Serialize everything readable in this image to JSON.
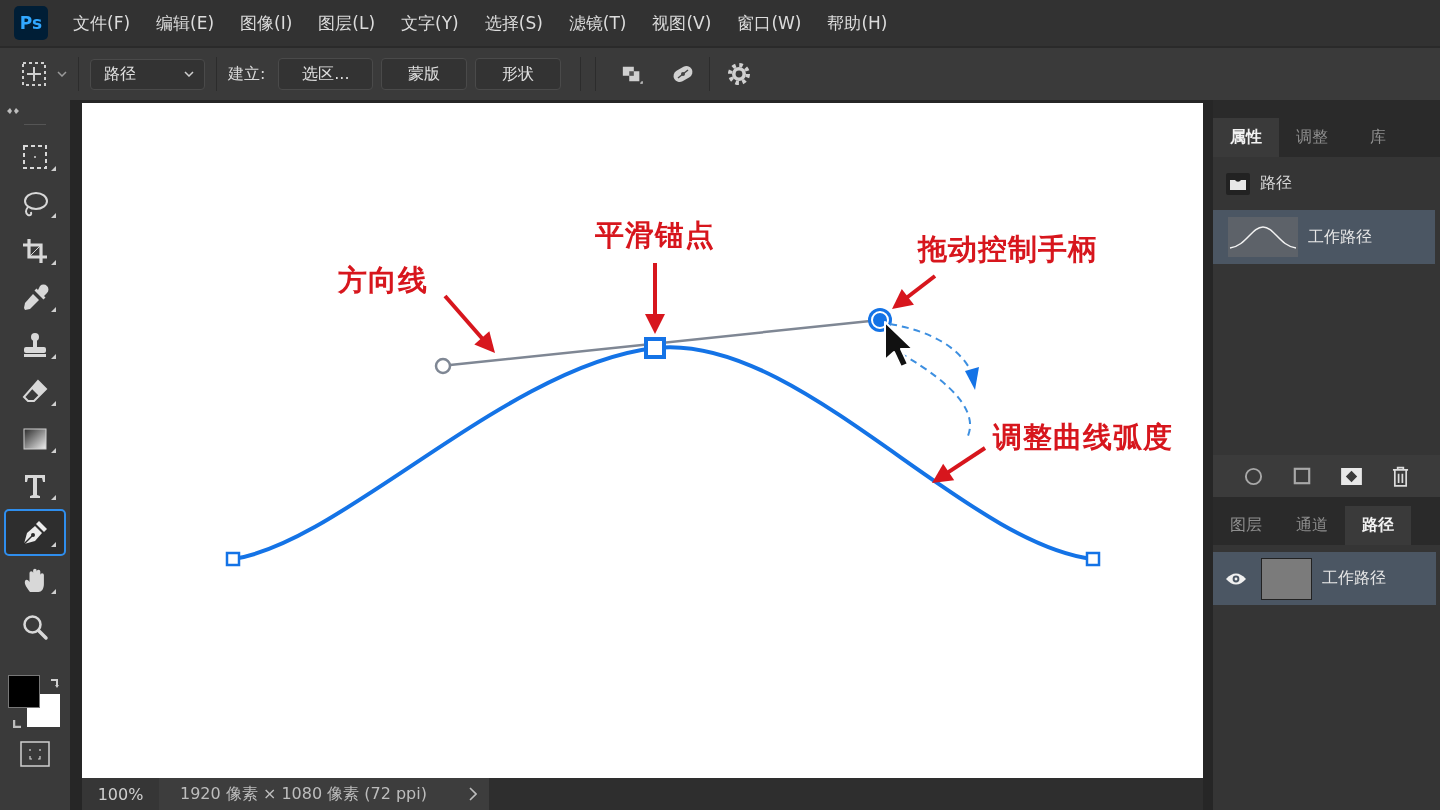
{
  "menu_bar": {
    "logo": "Ps",
    "items": [
      "文件(F)",
      "编辑(E)",
      "图像(I)",
      "图层(L)",
      "文字(Y)",
      "选择(S)",
      "滤镜(T)",
      "视图(V)",
      "窗口(W)",
      "帮助(H)"
    ]
  },
  "options_bar": {
    "mode": "路径",
    "make_label": "建立:",
    "make_buttons": [
      "选区...",
      "蒙版",
      "形状"
    ]
  },
  "toolbar": {
    "tools": [
      {
        "kind": "marquee",
        "selected": false,
        "flyout": true
      },
      {
        "kind": "lasso",
        "selected": false,
        "flyout": true
      },
      {
        "kind": "crop",
        "selected": false,
        "flyout": true
      },
      {
        "kind": "eyedropper",
        "selected": false,
        "flyout": true
      },
      {
        "kind": "stamp",
        "selected": false,
        "flyout": true
      },
      {
        "kind": "eraser",
        "selected": false,
        "flyout": true
      },
      {
        "kind": "gradient",
        "selected": false,
        "flyout": true
      },
      {
        "kind": "type",
        "selected": false,
        "flyout": true
      },
      {
        "kind": "pen",
        "selected": true,
        "flyout": true
      },
      {
        "kind": "hand",
        "selected": false,
        "flyout": true
      },
      {
        "kind": "zoom",
        "selected": false,
        "flyout": false
      }
    ]
  },
  "canvas": {
    "annotations": [
      {
        "kind": "direction_line",
        "text": "方向线"
      },
      {
        "kind": "anchor",
        "text": "平滑锚点"
      },
      {
        "kind": "handle",
        "text": "拖动控制手柄"
      },
      {
        "kind": "curve",
        "text": "调整曲线弧度"
      }
    ]
  },
  "properties_panel": {
    "tabs": [
      {
        "label": "属性",
        "selected": true
      },
      {
        "label": "调整",
        "selected": false
      },
      {
        "label": "库",
        "selected": false
      }
    ],
    "section": "路径",
    "items": [
      {
        "name": "工作路径",
        "selected": true
      }
    ]
  },
  "paths_panel": {
    "tabs": [
      {
        "label": "图层",
        "selected": false
      },
      {
        "label": "通道",
        "selected": false
      },
      {
        "label": "路径",
        "selected": true
      }
    ],
    "rows": [
      {
        "name": "工作路径",
        "visible": true,
        "selected": true
      }
    ]
  },
  "status_bar": {
    "zoom": "100%",
    "document_info": "1920 像素 × 1080 像素 (72 ppi)"
  }
}
